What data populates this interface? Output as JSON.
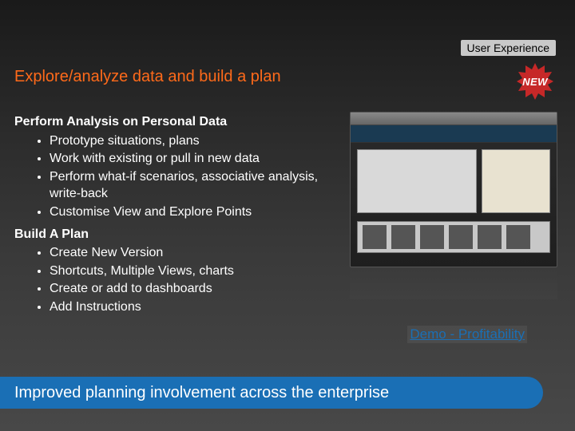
{
  "header": {
    "category": "User Experience",
    "title": "Explore/analyze data and build a plan",
    "badge": "NEW"
  },
  "analysis": {
    "heading": "Perform Analysis on Personal Data",
    "bullets": [
      "Prototype situations, plans",
      "Work with existing or pull in new data",
      "Perform what-if scenarios, associative analysis, write-back",
      "Customise View and Explore Points"
    ]
  },
  "plan": {
    "heading": "Build A Plan",
    "bullets": [
      "Create New Version",
      "Shortcuts, Multiple Views, charts",
      "Create or add to dashboards",
      "Add Instructions"
    ]
  },
  "demo": {
    "label": "Demo - Profitability"
  },
  "footer": {
    "text": "Improved planning involvement across the enterprise"
  }
}
